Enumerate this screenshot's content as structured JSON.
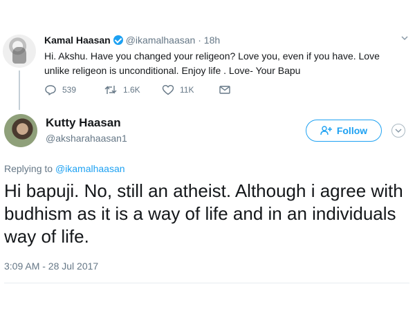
{
  "tweet1": {
    "name": "Kamal Haasan",
    "handle": "@ikamalhaasan",
    "separator": "·",
    "time": "18h",
    "text": "Hi. Akshu. Have you changed your religeon?  Love you, even if you have. Love unlike religeon is unconditional. Enjoy life . Love- Your Bapu",
    "replies": "539",
    "retweets": "1.6K",
    "likes": "11K"
  },
  "tweet2": {
    "name": "Kutty Haasan",
    "handle": "@aksharahaasan1",
    "follow_label": "Follow",
    "replying_label": "Replying to",
    "replying_handle": "@ikamalhaasan",
    "text": "Hi bapuji. No, still an atheist. Although i agree with budhism as it is a way of life and in an individuals way of life.",
    "timestamp": "3:09 AM - 28 Jul 2017"
  },
  "colors": {
    "accent": "#1da1f2",
    "muted": "#657786",
    "text": "#14171a"
  },
  "icons": [
    "verified-icon",
    "chevron-down-icon",
    "reply-icon",
    "retweet-icon",
    "like-icon",
    "message-icon",
    "follow-person-icon"
  ]
}
